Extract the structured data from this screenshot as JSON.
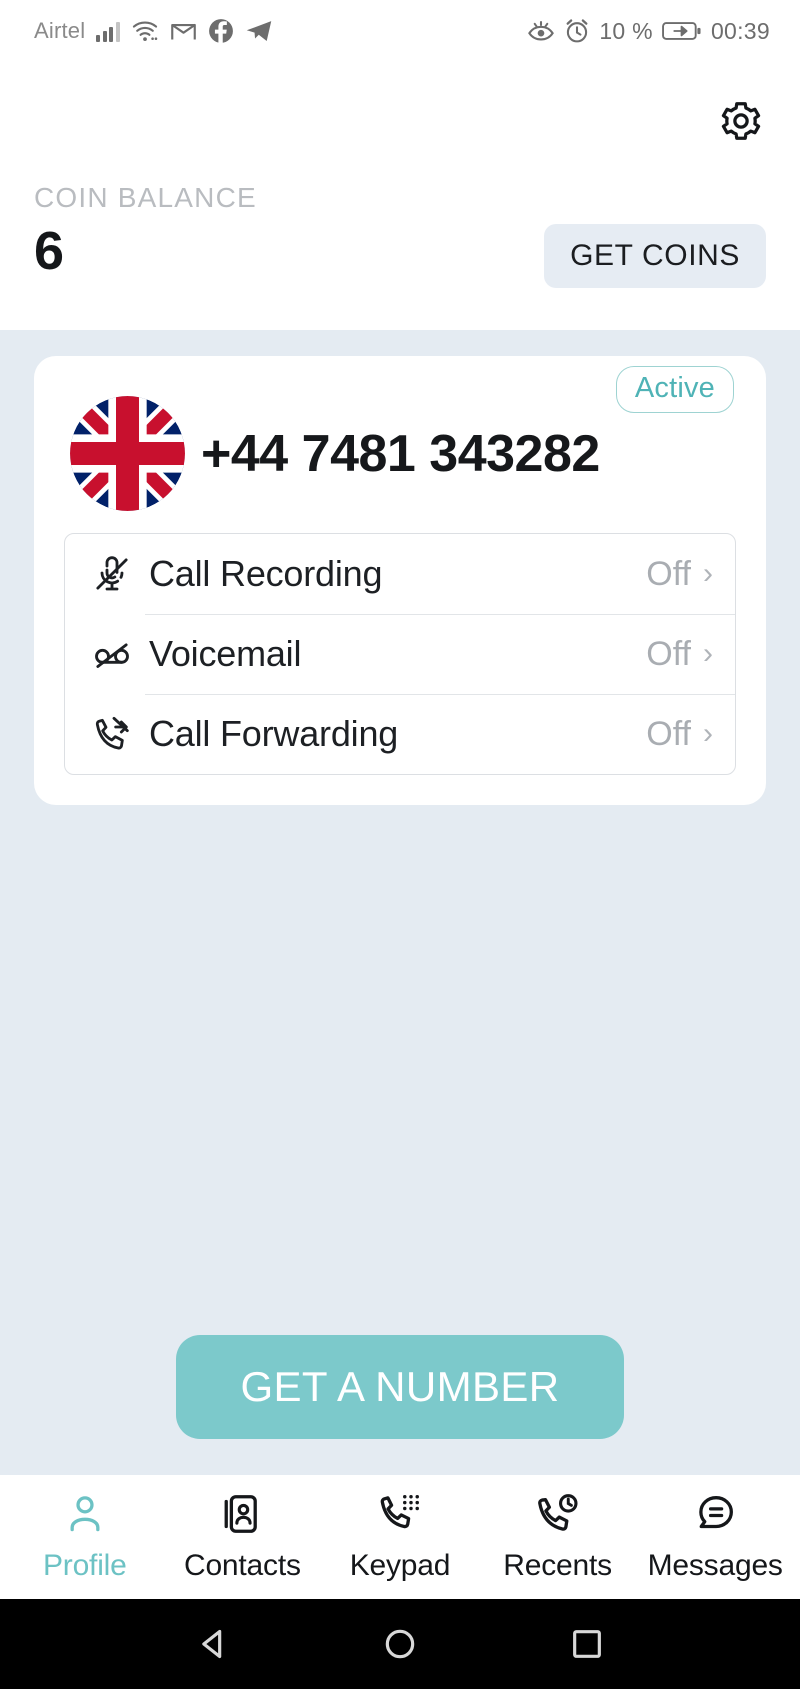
{
  "statusbar": {
    "carrier": "Airtel",
    "icons_left": [
      "signal-bars-icon",
      "wifi-icon",
      "gmail-icon",
      "facebook-icon",
      "telegram-icon"
    ],
    "battery_percent": "10 %",
    "time": "00:39",
    "icons_right": [
      "eye-comfort-icon",
      "alarm-clock-icon",
      "battery-charging-icon"
    ]
  },
  "header": {
    "settings_icon": "gear-icon",
    "coin_balance_label": "COIN BALANCE",
    "coin_balance_value": "6",
    "get_coins_label": "GET COINS"
  },
  "number_card": {
    "flag": "uk-flag-icon",
    "phone_number": "+44 7481 343282",
    "status_badge": "Active",
    "features": [
      {
        "icon": "mic-off-icon",
        "label": "Call Recording",
        "value": "Off",
        "chevron": "›"
      },
      {
        "icon": "voicemail-off-icon",
        "label": "Voicemail",
        "value": "Off",
        "chevron": "›"
      },
      {
        "icon": "call-forward-off-icon",
        "label": "Call Forwarding",
        "value": "Off",
        "chevron": "›"
      }
    ]
  },
  "cta": {
    "label": "GET A NUMBER"
  },
  "tabbar": {
    "items": [
      {
        "label": "Profile",
        "icon": "person-icon",
        "active": true
      },
      {
        "label": "Contacts",
        "icon": "contacts-icon",
        "active": false
      },
      {
        "label": "Keypad",
        "icon": "keypad-icon",
        "active": false
      },
      {
        "label": "Recents",
        "icon": "recents-icon",
        "active": false
      },
      {
        "label": "Messages",
        "icon": "messages-icon",
        "active": false
      }
    ]
  },
  "navbar": {
    "buttons": [
      "back-icon",
      "home-icon",
      "recents-square-icon"
    ]
  },
  "colors": {
    "accent_teal": "#6cc2c4",
    "cta_teal": "#7cc9cb",
    "body_bg": "#e4ebf2",
    "chip_bg": "#e6ecf3",
    "muted_text": "#a9adb2"
  }
}
